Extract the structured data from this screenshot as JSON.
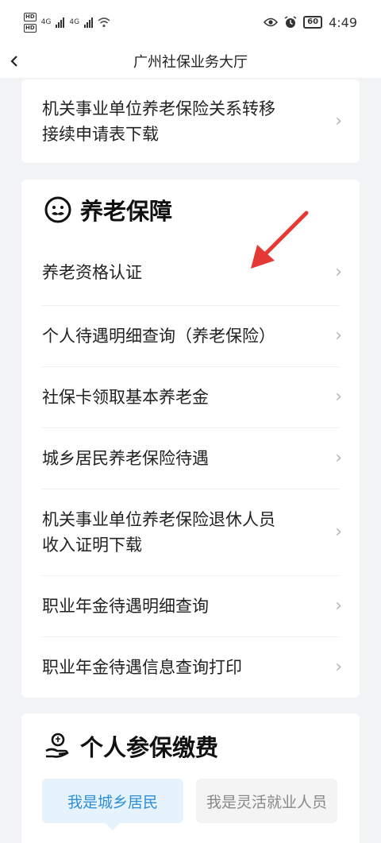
{
  "status_bar": {
    "net1": "4G",
    "net2": "4G",
    "hd": "HD",
    "battery": "60",
    "time": "4:49"
  },
  "nav": {
    "back_icon": "chevron-left-icon",
    "title": "广州社保业务大厅"
  },
  "top_card": {
    "items": [
      {
        "line1": "机关事业单位养老保险关系转移",
        "line2": "接续申请表下载"
      }
    ]
  },
  "pension_section": {
    "title": "养老保障",
    "icon": "elderly-face-icon",
    "items": [
      {
        "label": "养老资格认证"
      },
      {
        "label": "个人待遇明细查询（养老保险）"
      },
      {
        "label": "社保卡领取基本养老金"
      },
      {
        "label": "城乡居民养老保险待遇"
      },
      {
        "line1": "机关事业单位养老保险退休人员",
        "line2": "收入证明下载"
      },
      {
        "label": "职业年金待遇明细查询"
      },
      {
        "label": "职业年金待遇信息查询打印"
      }
    ]
  },
  "payment_section": {
    "title": "个人参保缴费",
    "icon": "hand-person-icon",
    "tabs": [
      {
        "label": "我是城乡居民",
        "active": true
      },
      {
        "label": "我是灵活就业人员",
        "active": false
      }
    ]
  },
  "colors": {
    "accent": "#2e8fd8",
    "annotation_arrow": "#e53935",
    "background": "#f2f3f5"
  }
}
